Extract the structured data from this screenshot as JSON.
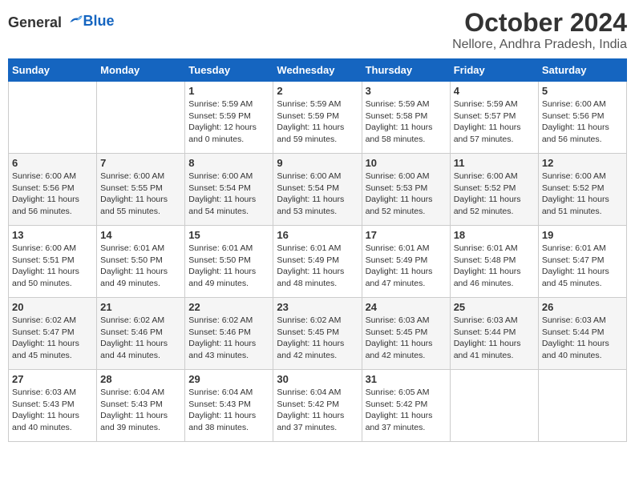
{
  "logo": {
    "general": "General",
    "blue": "Blue"
  },
  "title": "October 2024",
  "subtitle": "Nellore, Andhra Pradesh, India",
  "days_of_week": [
    "Sunday",
    "Monday",
    "Tuesday",
    "Wednesday",
    "Thursday",
    "Friday",
    "Saturday"
  ],
  "weeks": [
    [
      {
        "day": "",
        "info": ""
      },
      {
        "day": "",
        "info": ""
      },
      {
        "day": "1",
        "info": "Sunrise: 5:59 AM\nSunset: 5:59 PM\nDaylight: 12 hours and 0 minutes."
      },
      {
        "day": "2",
        "info": "Sunrise: 5:59 AM\nSunset: 5:59 PM\nDaylight: 11 hours and 59 minutes."
      },
      {
        "day": "3",
        "info": "Sunrise: 5:59 AM\nSunset: 5:58 PM\nDaylight: 11 hours and 58 minutes."
      },
      {
        "day": "4",
        "info": "Sunrise: 5:59 AM\nSunset: 5:57 PM\nDaylight: 11 hours and 57 minutes."
      },
      {
        "day": "5",
        "info": "Sunrise: 6:00 AM\nSunset: 5:56 PM\nDaylight: 11 hours and 56 minutes."
      }
    ],
    [
      {
        "day": "6",
        "info": "Sunrise: 6:00 AM\nSunset: 5:56 PM\nDaylight: 11 hours and 56 minutes."
      },
      {
        "day": "7",
        "info": "Sunrise: 6:00 AM\nSunset: 5:55 PM\nDaylight: 11 hours and 55 minutes."
      },
      {
        "day": "8",
        "info": "Sunrise: 6:00 AM\nSunset: 5:54 PM\nDaylight: 11 hours and 54 minutes."
      },
      {
        "day": "9",
        "info": "Sunrise: 6:00 AM\nSunset: 5:54 PM\nDaylight: 11 hours and 53 minutes."
      },
      {
        "day": "10",
        "info": "Sunrise: 6:00 AM\nSunset: 5:53 PM\nDaylight: 11 hours and 52 minutes."
      },
      {
        "day": "11",
        "info": "Sunrise: 6:00 AM\nSunset: 5:52 PM\nDaylight: 11 hours and 52 minutes."
      },
      {
        "day": "12",
        "info": "Sunrise: 6:00 AM\nSunset: 5:52 PM\nDaylight: 11 hours and 51 minutes."
      }
    ],
    [
      {
        "day": "13",
        "info": "Sunrise: 6:00 AM\nSunset: 5:51 PM\nDaylight: 11 hours and 50 minutes."
      },
      {
        "day": "14",
        "info": "Sunrise: 6:01 AM\nSunset: 5:50 PM\nDaylight: 11 hours and 49 minutes."
      },
      {
        "day": "15",
        "info": "Sunrise: 6:01 AM\nSunset: 5:50 PM\nDaylight: 11 hours and 49 minutes."
      },
      {
        "day": "16",
        "info": "Sunrise: 6:01 AM\nSunset: 5:49 PM\nDaylight: 11 hours and 48 minutes."
      },
      {
        "day": "17",
        "info": "Sunrise: 6:01 AM\nSunset: 5:49 PM\nDaylight: 11 hours and 47 minutes."
      },
      {
        "day": "18",
        "info": "Sunrise: 6:01 AM\nSunset: 5:48 PM\nDaylight: 11 hours and 46 minutes."
      },
      {
        "day": "19",
        "info": "Sunrise: 6:01 AM\nSunset: 5:47 PM\nDaylight: 11 hours and 45 minutes."
      }
    ],
    [
      {
        "day": "20",
        "info": "Sunrise: 6:02 AM\nSunset: 5:47 PM\nDaylight: 11 hours and 45 minutes."
      },
      {
        "day": "21",
        "info": "Sunrise: 6:02 AM\nSunset: 5:46 PM\nDaylight: 11 hours and 44 minutes."
      },
      {
        "day": "22",
        "info": "Sunrise: 6:02 AM\nSunset: 5:46 PM\nDaylight: 11 hours and 43 minutes."
      },
      {
        "day": "23",
        "info": "Sunrise: 6:02 AM\nSunset: 5:45 PM\nDaylight: 11 hours and 42 minutes."
      },
      {
        "day": "24",
        "info": "Sunrise: 6:03 AM\nSunset: 5:45 PM\nDaylight: 11 hours and 42 minutes."
      },
      {
        "day": "25",
        "info": "Sunrise: 6:03 AM\nSunset: 5:44 PM\nDaylight: 11 hours and 41 minutes."
      },
      {
        "day": "26",
        "info": "Sunrise: 6:03 AM\nSunset: 5:44 PM\nDaylight: 11 hours and 40 minutes."
      }
    ],
    [
      {
        "day": "27",
        "info": "Sunrise: 6:03 AM\nSunset: 5:43 PM\nDaylight: 11 hours and 40 minutes."
      },
      {
        "day": "28",
        "info": "Sunrise: 6:04 AM\nSunset: 5:43 PM\nDaylight: 11 hours and 39 minutes."
      },
      {
        "day": "29",
        "info": "Sunrise: 6:04 AM\nSunset: 5:43 PM\nDaylight: 11 hours and 38 minutes."
      },
      {
        "day": "30",
        "info": "Sunrise: 6:04 AM\nSunset: 5:42 PM\nDaylight: 11 hours and 37 minutes."
      },
      {
        "day": "31",
        "info": "Sunrise: 6:05 AM\nSunset: 5:42 PM\nDaylight: 11 hours and 37 minutes."
      },
      {
        "day": "",
        "info": ""
      },
      {
        "day": "",
        "info": ""
      }
    ]
  ]
}
